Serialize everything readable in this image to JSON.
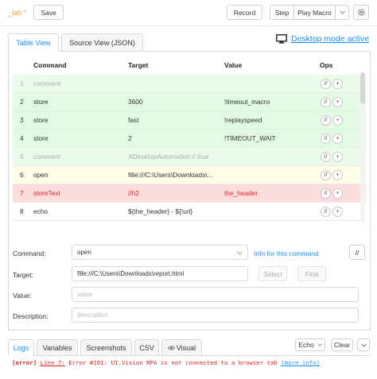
{
  "toolbar": {
    "macro_name": "_lab *",
    "save_label": "Save",
    "record_label": "Record",
    "step_label": "Step",
    "play_label": "Play Macro",
    "gear_icon": "gear-icon",
    "chevron_icon": "chevron-down-icon"
  },
  "view_tabs": {
    "table": "Table View",
    "source": "Source View (JSON)",
    "active": "Table View"
  },
  "desktop_mode": {
    "label": "Desktop mode active",
    "icon": "monitor-icon"
  },
  "table": {
    "headers": [
      "",
      "Command",
      "Target",
      "Value",
      "Ops"
    ],
    "rows": [
      {
        "num": "1",
        "command": "comment",
        "target": "",
        "value": "",
        "style": "comment"
      },
      {
        "num": "2",
        "command": "store",
        "target": "3600",
        "value": "!timeout_macro",
        "style": "ok"
      },
      {
        "num": "3",
        "command": "store",
        "target": "fast",
        "value": "!replayspeed",
        "style": "ok"
      },
      {
        "num": "4",
        "command": "store",
        "target": "2",
        "value": "!TIMEOUT_WAIT",
        "style": "ok"
      },
      {
        "num": "5",
        "command": "comment",
        "target": "XDesktopAutomation // true",
        "value": "",
        "style": "comment"
      },
      {
        "num": "6",
        "command": "open",
        "target": "fille:///C:\\Users\\Downloads\\...",
        "value": "",
        "style": "current"
      },
      {
        "num": "7",
        "command": "storeText",
        "target": "//h2",
        "value": "the_header",
        "style": "error"
      },
      {
        "num": "8",
        "command": "echo",
        "target": "${the_header} - ${!url}",
        "value": "",
        "style": "plain"
      }
    ],
    "ops_labels": [
      "//",
      "+"
    ]
  },
  "editor": {
    "command_label": "Command:",
    "command_value": "open",
    "info_link": "Info for this command",
    "comment_toggle": "//",
    "target_label": "Target:",
    "target_value": "fille:///C:\\Users\\Downloads\\report.html",
    "select_label": "Select",
    "find_label": "Find",
    "value_label": "Value:",
    "value_placeholder": "value",
    "description_label": "Description:",
    "description_placeholder": "description"
  },
  "bottom_tabs": {
    "logs": "Logs",
    "variables": "Variables",
    "screenshots": "Screenshots",
    "csv": "CSV",
    "visual": "Visual",
    "active": "Logs"
  },
  "log_controls": {
    "echo": "Echo",
    "clear": "Clear"
  },
  "log": {
    "tag": "[error]",
    "line_link": "Line 7:",
    "message": "Error #101: UI.Vision RPA is not connected to a browser tab",
    "more_info": "(more info)"
  },
  "colors": {
    "accent": "#1890ff",
    "row_ok": "#e3fbe3",
    "row_comment": "#eafbe9",
    "row_current": "#fffde6",
    "row_error": "#fcdcdc",
    "error_text": "#e51f1f",
    "macro_name": "#e8a33a"
  }
}
